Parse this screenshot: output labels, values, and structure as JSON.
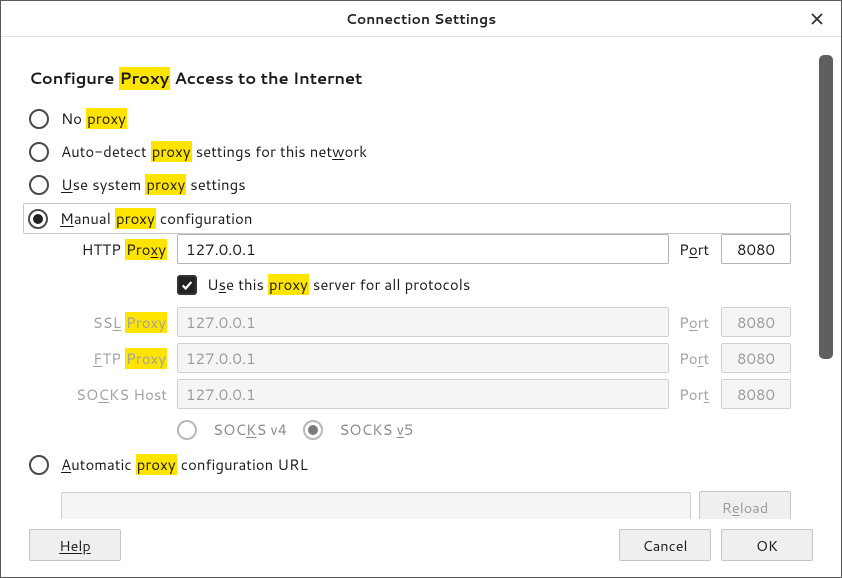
{
  "title": "Connection Settings",
  "section_heading": {
    "pre": "Configure ",
    "hl": "Proxy",
    "post": " Access to the Internet"
  },
  "radios": {
    "no_proxy": {
      "pre": "No ",
      "hl": "proxy",
      "post": ""
    },
    "auto_detect": {
      "pre": "Auto-detect ",
      "hl": "proxy",
      "post": " settings for this net",
      "u": "w",
      "post2": "ork"
    },
    "system": {
      "u": "U",
      "pre": "se system ",
      "hl": "proxy",
      "post": " settings"
    },
    "manual": {
      "u": "M",
      "pre": "anual ",
      "hl": "proxy",
      "post": " configuration"
    },
    "automatic": {
      "u": "A",
      "pre": "utomatic ",
      "hl": "proxy",
      "post": " configuration URL"
    }
  },
  "proxy": {
    "http_label": {
      "pre": "HTTP ",
      "hl": "Pro",
      "u": "x",
      "hl2": "y"
    },
    "ssl_label": {
      "pre": "SS",
      "u": "L",
      "post": " ",
      "hl": "Proxy"
    },
    "ftp_label": {
      "u": "F",
      "pre": "TP ",
      "hl": "Proxy"
    },
    "socks_label": {
      "pre": "SO",
      "u": "C",
      "post": "KS Host"
    },
    "port_label_http": {
      "pre": "P",
      "u": "o",
      "post": "rt"
    },
    "port_label_ssl": {
      "pre": "P",
      "u": "o",
      "post": "rt"
    },
    "port_label_ftp": {
      "pre": "Po",
      "u": "r",
      "post": "t"
    },
    "port_label_socks": {
      "pre": "Por",
      "u": "t",
      "post": ""
    },
    "http_host": "127.0.0.1",
    "http_port": "8080",
    "ssl_host": "127.0.0.1",
    "ssl_port": "8080",
    "ftp_host": "127.0.0.1",
    "ftp_port": "8080",
    "socks_host": "127.0.0.1",
    "socks_port": "8080",
    "use_for_all": {
      "pre": "U",
      "u": "s",
      "pre2": "e this ",
      "hl": "proxy",
      "post": " server for all protocols"
    },
    "socks_v4": {
      "pre": "SOC",
      "u": "K",
      "post": "S v4"
    },
    "socks_v5": {
      "pre": "SOCKS ",
      "u": "v",
      "post": "5"
    }
  },
  "auto_url": "",
  "buttons": {
    "reload": "Reload",
    "help": "Help",
    "cancel": "Cancel",
    "ok": "OK"
  }
}
